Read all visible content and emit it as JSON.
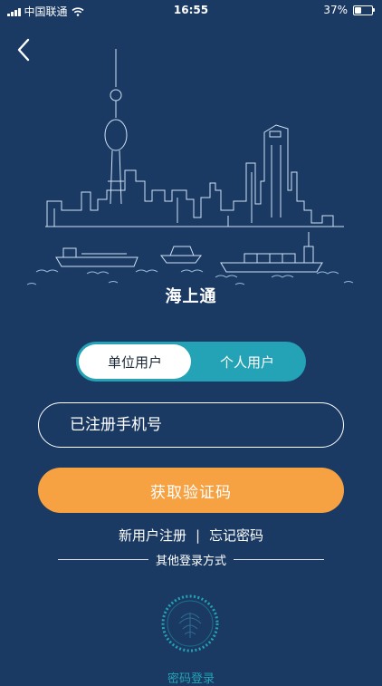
{
  "status_bar": {
    "carrier": "中国联通",
    "time": "16:55",
    "battery": "37%",
    "battery_level": 0.37
  },
  "header": {
    "back_icon": "chevron-left-icon"
  },
  "app": {
    "title": "海上通"
  },
  "user_type": {
    "options": [
      "单位用户",
      "个人用户"
    ],
    "selected": "单位用户"
  },
  "phone": {
    "placeholder": "已注册手机号",
    "value": ""
  },
  "actions": {
    "get_code": "获取验证码",
    "register": "新用户注册",
    "separator": "|",
    "forgot_password": "忘记密码"
  },
  "other_login": {
    "heading": "其他登录方式",
    "option_label": "密码登录",
    "option_icon": "password-login-icon"
  },
  "colors": {
    "background": "#1b3a63",
    "accent": "#23a3b5",
    "primary_button": "#f7a242"
  }
}
